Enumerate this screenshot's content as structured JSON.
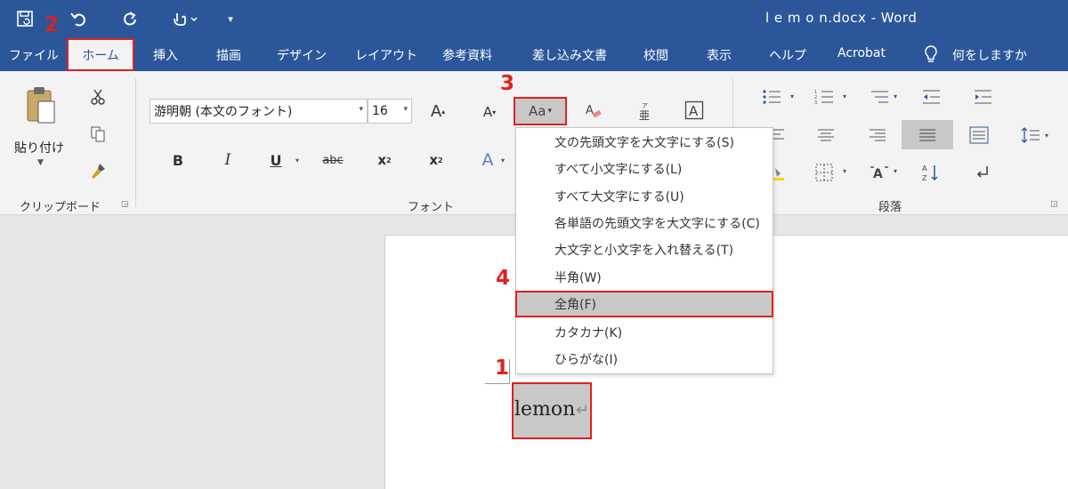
{
  "titlebar": {
    "doc_title": "l e m o n.docx  -  Word",
    "qat_icons": [
      "save-icon",
      "undo-icon",
      "redo-icon",
      "touch-mode-icon",
      "customize-qat-icon"
    ]
  },
  "tabs": [
    {
      "label": "ファイル"
    },
    {
      "label": "ホーム"
    },
    {
      "label": "挿入"
    },
    {
      "label": "描画"
    },
    {
      "label": "デザイン"
    },
    {
      "label": "レイアウト"
    },
    {
      "label": "参考資料"
    },
    {
      "label": "差し込み文書"
    },
    {
      "label": "校閲"
    },
    {
      "label": "表示"
    },
    {
      "label": "ヘルプ"
    },
    {
      "label": "Acrobat"
    },
    {
      "label": "何をしますか"
    }
  ],
  "clipboard": {
    "paste_label": "貼り付け",
    "group_label": "クリップボード"
  },
  "font": {
    "font_name": "游明朝 (本文のフォント)",
    "font_size": "16",
    "group_label": "フォント",
    "grow_glyph": "A",
    "shrink_glyph": "A",
    "case_glyph": "Aa",
    "bold_glyph": "B",
    "italic_glyph": "I",
    "underline_glyph": "U",
    "strike_glyph": "abc",
    "sub_glyph": "x",
    "sup_glyph": "x",
    "effects_glyph": "A"
  },
  "paragraph": {
    "group_label": "段落"
  },
  "case_menu": {
    "items": [
      {
        "label": "文の先頭文字を大文字にする(S)"
      },
      {
        "label": "すべて小文字にする(L)"
      },
      {
        "label": "すべて大文字にする(U)"
      },
      {
        "label": "各単語の先頭文字を大文字にする(C)"
      },
      {
        "label": "大文字と小文字を入れ替える(T)"
      },
      {
        "label": "半角(W)"
      },
      {
        "label": "全角(F)"
      },
      {
        "label": "カタカナ(K)"
      },
      {
        "label": "ひらがな(I)"
      }
    ],
    "selected_index": 6
  },
  "document": {
    "text": "lemon",
    "para_mark": "↵"
  },
  "steps": [
    "1",
    "2",
    "3",
    "4"
  ],
  "colors": {
    "brand": "#2b579a",
    "highlight": "#e02020",
    "selection": "#c8c8c8"
  }
}
